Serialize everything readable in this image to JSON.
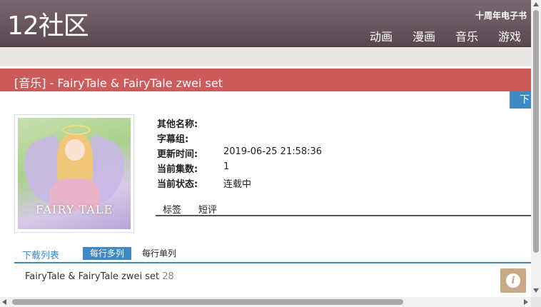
{
  "header": {
    "logo": "12社区",
    "top_link": "十周年电子书",
    "nav": [
      "动画",
      "漫画",
      "音乐",
      "游戏"
    ]
  },
  "title": "[音乐] - FairyTale & FairyTale zwei set",
  "download_tab": "下",
  "cover": {
    "caption": "FAIRY TALE"
  },
  "info": {
    "fields": [
      {
        "label": "其他名称:",
        "value": ""
      },
      {
        "label": "字幕组:",
        "value": ""
      },
      {
        "label": "更新时间:",
        "value": "2019-06-25 21:58:36"
      },
      {
        "label": "当前集数:",
        "value": "1"
      },
      {
        "label": "当前状态:",
        "value": "连载中"
      }
    ]
  },
  "tabs": [
    "标签",
    "短评"
  ],
  "download": {
    "title": "下载列表",
    "mode_multi": "每行多列",
    "mode_single": "每行单列",
    "item_name": "FairyTale & FairyTale zwei set",
    "item_size": "28"
  },
  "icons": {
    "info": "info-icon"
  },
  "colors": {
    "title_bar": "#cd5b5b",
    "accent": "#3f89c5",
    "header": "#6b5861"
  }
}
